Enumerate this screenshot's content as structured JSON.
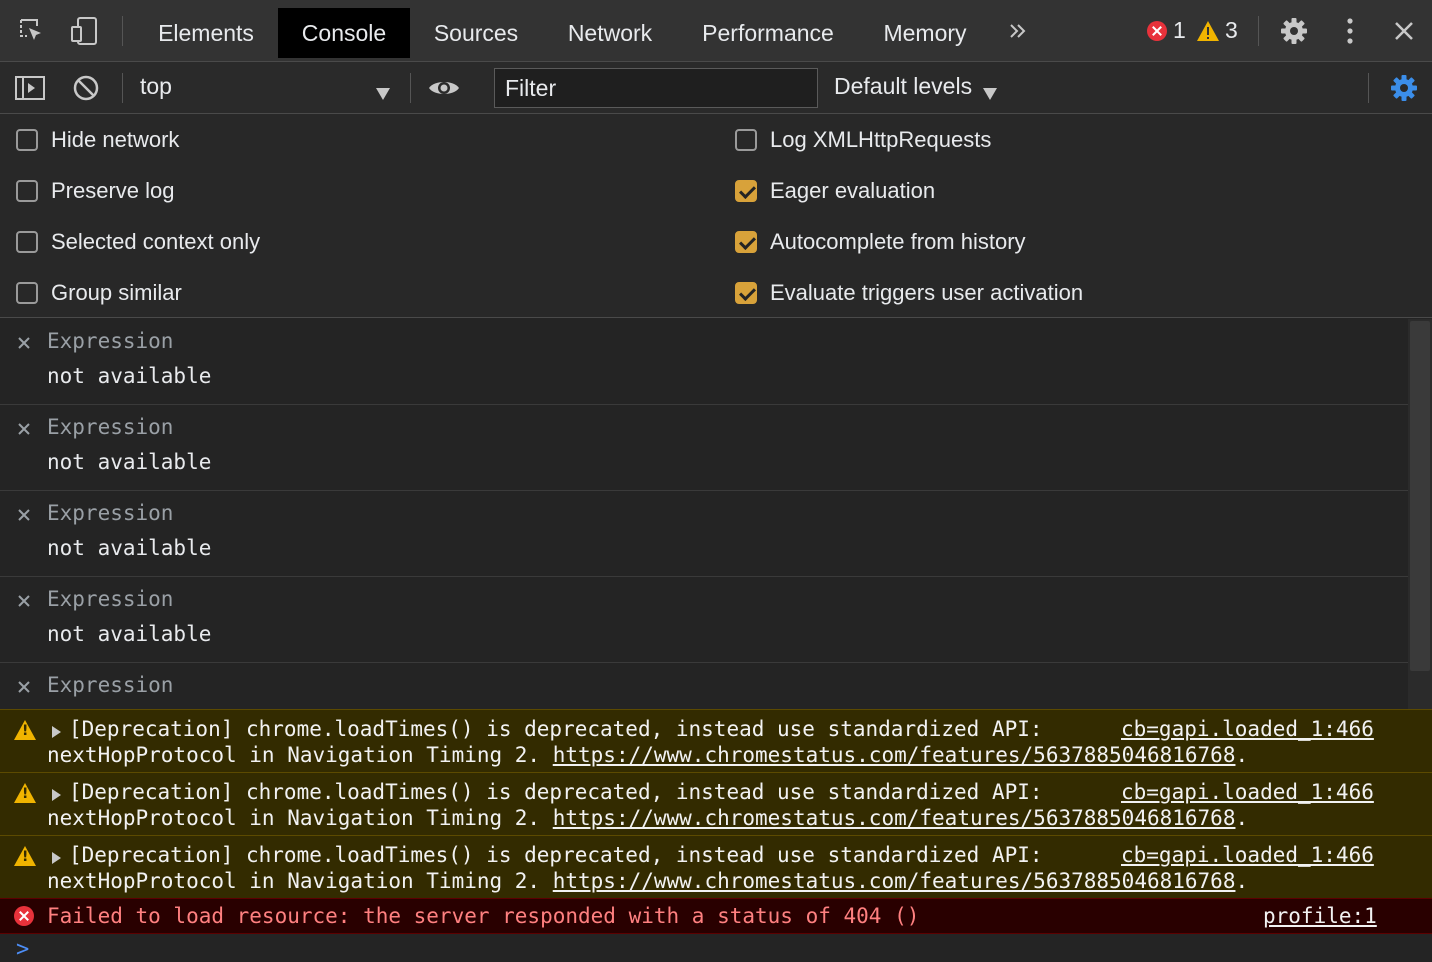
{
  "tabbar": {
    "tabs": [
      {
        "label": "Elements"
      },
      {
        "label": "Console"
      },
      {
        "label": "Sources"
      },
      {
        "label": "Network"
      },
      {
        "label": "Performance"
      },
      {
        "label": "Memory"
      }
    ],
    "more_tabs_icon": "double-chevron-right-icon",
    "error_count": "1",
    "warning_count": "3"
  },
  "toolbar": {
    "context": "top",
    "filter_placeholder": "Filter",
    "levels": "Default levels"
  },
  "settings": {
    "left": [
      {
        "label": "Hide network",
        "checked": false
      },
      {
        "label": "Preserve log",
        "checked": false
      },
      {
        "label": "Selected context only",
        "checked": false
      },
      {
        "label": "Group similar",
        "checked": false
      }
    ],
    "right": [
      {
        "label": "Log XMLHttpRequests",
        "checked": false
      },
      {
        "label": "Eager evaluation",
        "checked": true
      },
      {
        "label": "Autocomplete from history",
        "checked": true
      },
      {
        "label": "Evaluate triggers user activation",
        "checked": true
      }
    ]
  },
  "live_expressions": [
    {
      "name": "Expression",
      "value": "not available"
    },
    {
      "name": "Expression",
      "value": "not available"
    },
    {
      "name": "Expression",
      "value": "not available"
    },
    {
      "name": "Expression",
      "value": "not available"
    },
    {
      "name": "Expression",
      "value": ""
    }
  ],
  "messages": {
    "warnings": [
      {
        "line1": "[Deprecation] chrome.loadTimes() is deprecated, instead use standardized API:",
        "line2_text": "nextHopProtocol in Navigation Timing 2. ",
        "url": "https://www.chromestatus.com/features/5637885046816768",
        "tail": ".",
        "source": "cb=gapi.loaded_1:466"
      },
      {
        "line1": "[Deprecation] chrome.loadTimes() is deprecated, instead use standardized API:",
        "line2_text": "nextHopProtocol in Navigation Timing 2. ",
        "url": "https://www.chromestatus.com/features/5637885046816768",
        "tail": ".",
        "source": "cb=gapi.loaded_1:466"
      },
      {
        "line1": "[Deprecation] chrome.loadTimes() is deprecated, instead use standardized API:",
        "line2_text": "nextHopProtocol in Navigation Timing 2. ",
        "url": "https://www.chromestatus.com/features/5637885046816768",
        "tail": ".",
        "source": "cb=gapi.loaded_1:466"
      }
    ],
    "error": {
      "text": "Failed to load resource: the server responded with a status of 404 ()",
      "source": "profile:1"
    }
  },
  "prompt": {
    "symbol": ">"
  },
  "colors": {
    "accent": "#d8a23a",
    "warning": "#f0b400",
    "error": "#e8323b",
    "link_blue": "#1a73e8"
  }
}
